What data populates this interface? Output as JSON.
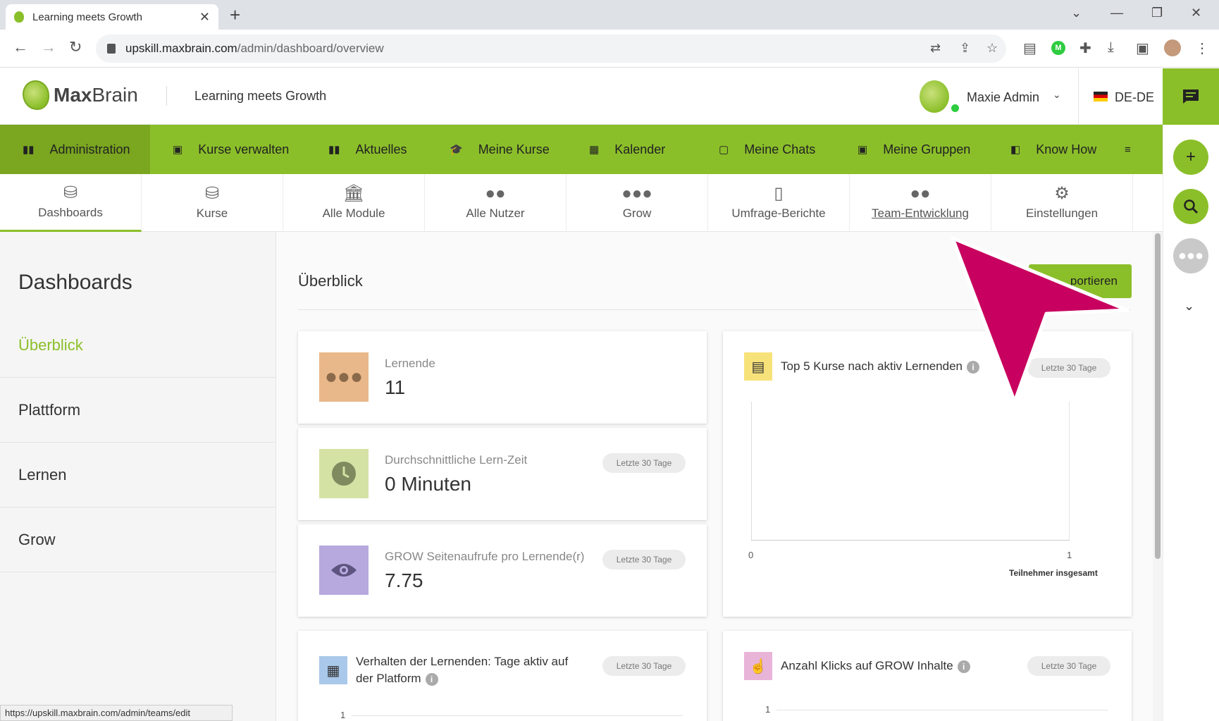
{
  "browser": {
    "tab_title": "Learning meets Growth",
    "url_host": "upskill.maxbrain.com",
    "url_path": "/admin/dashboard/overview",
    "status_url": "https://upskill.maxbrain.com/admin/teams/edit"
  },
  "header": {
    "logo_bold": "Max",
    "logo_light": "Brain",
    "site_title": "Learning meets Growth",
    "user_name": "Maxie Admin",
    "language": "DE-DE"
  },
  "main_nav": [
    {
      "label": "Administration",
      "icon": "admin-icon",
      "active": true
    },
    {
      "label": "Kurse verwalten",
      "icon": "courses-manage-icon"
    },
    {
      "label": "Aktuelles",
      "icon": "news-icon"
    },
    {
      "label": "Meine Kurse",
      "icon": "graduation-cap-icon"
    },
    {
      "label": "Kalender",
      "icon": "calendar-icon"
    },
    {
      "label": "Meine Chats",
      "icon": "chat-icon"
    },
    {
      "label": "Meine Gruppen",
      "icon": "groups-icon"
    },
    {
      "label": "Know How",
      "icon": "book-icon"
    }
  ],
  "sub_nav": [
    {
      "label": "Dashboards",
      "icon": "dashboard-icon",
      "active": true
    },
    {
      "label": "Kurse",
      "icon": "course-icon"
    },
    {
      "label": "Alle Module",
      "icon": "modules-icon"
    },
    {
      "label": "Alle Nutzer",
      "icon": "users-icon"
    },
    {
      "label": "Grow",
      "icon": "grow-icon"
    },
    {
      "label": "Umfrage-Berichte",
      "icon": "report-icon"
    },
    {
      "label": "Team-Entwicklung",
      "icon": "team-icon",
      "hovered": true
    },
    {
      "label": "Einstellungen",
      "icon": "settings-icon"
    }
  ],
  "sidebar": {
    "title": "Dashboards",
    "items": [
      {
        "label": "Überblick",
        "active": true
      },
      {
        "label": "Plattform"
      },
      {
        "label": "Lernen"
      },
      {
        "label": "Grow"
      }
    ]
  },
  "main": {
    "title": "Überblick",
    "export_label": "portieren"
  },
  "kpis": [
    {
      "label": "Lernende",
      "value": "11",
      "color": "#e9b88a",
      "icon": "people-icon"
    },
    {
      "label": "Durchschnittliche Lern-Zeit",
      "value": "0 Minuten",
      "pill": "Letzte 30 Tage",
      "color": "#d4e2a4",
      "icon": "clock-icon"
    },
    {
      "label": "GROW Seitenaufrufe pro Lernende(r)",
      "value": "7.75",
      "pill": "Letzte 30 Tage",
      "color": "#b7a9de",
      "icon": "eye-icon"
    }
  ],
  "top_courses": {
    "title": "Top 5 Kurse nach aktiv Lernenden",
    "pill": "Letzte 30 Tage",
    "x_min": "0",
    "x_max": "1",
    "x_label": "Teilnehmer insgesamt"
  },
  "behaviour": {
    "title": "Verhalten der Lernenden: Tage aktiv auf der Platform",
    "pill": "Letzte 30 Tage",
    "y_tick": "1"
  },
  "clicks": {
    "title": "Anzahl Klicks auf GROW Inhalte",
    "pill": "Letzte 30 Tage",
    "y_tick": "1"
  },
  "colors": {
    "brand_green": "#8bbf2a",
    "pointer_magenta": "#c8005f"
  }
}
